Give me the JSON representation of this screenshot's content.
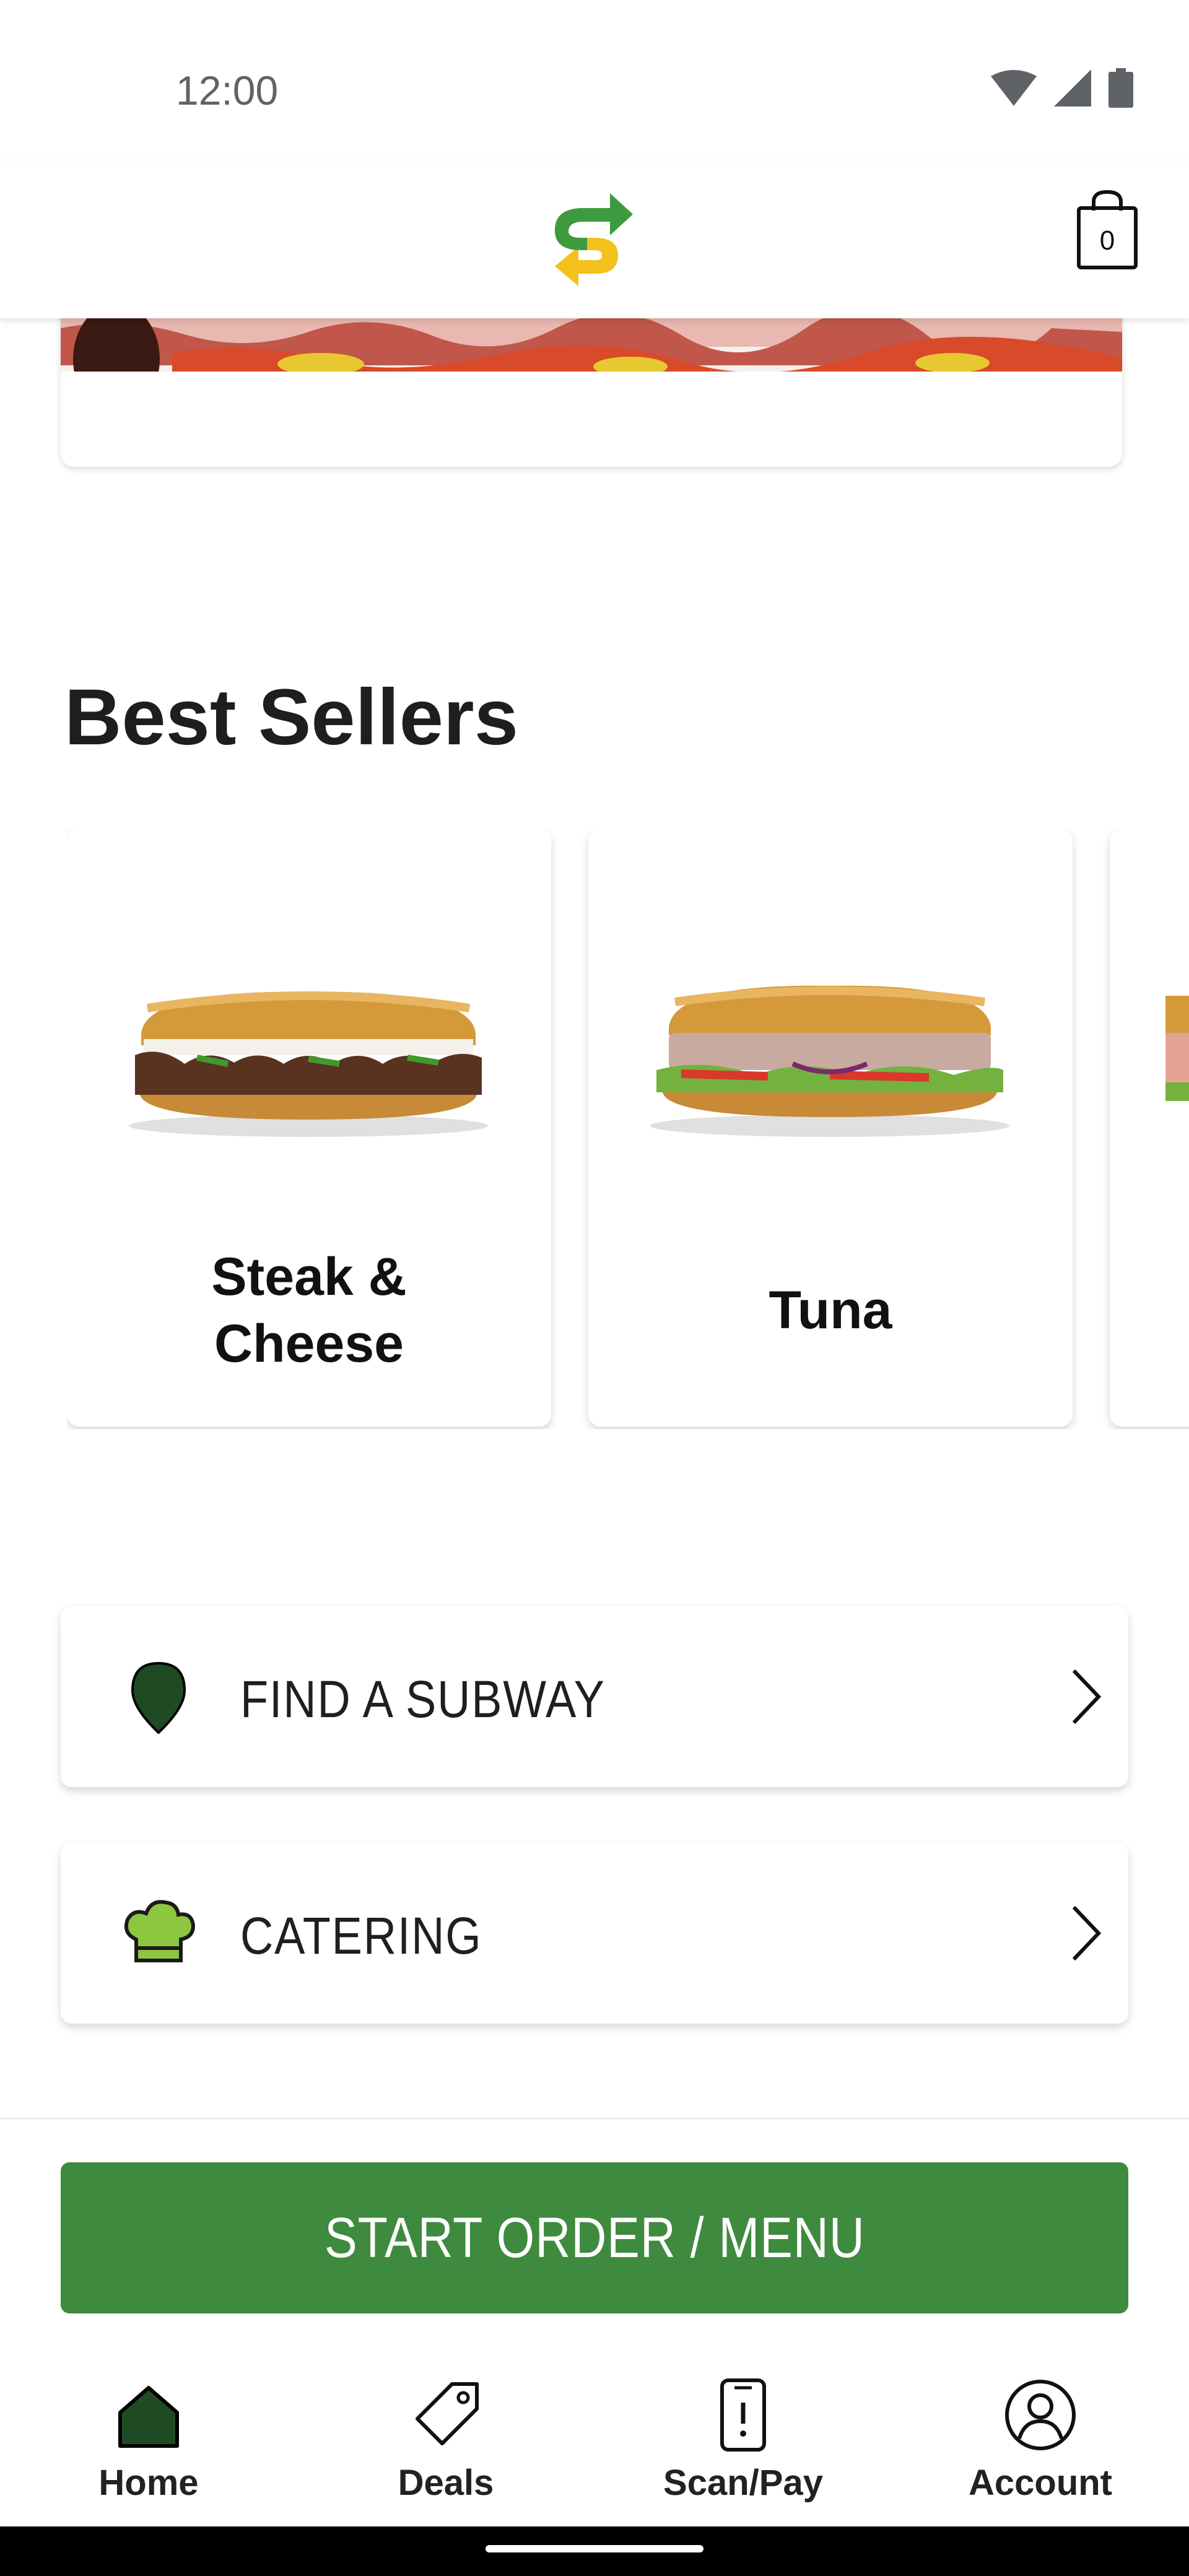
{
  "status_bar": {
    "time": "12:00"
  },
  "header": {
    "cart_count": "0"
  },
  "best_sellers": {
    "title": "Best Sellers",
    "items": [
      {
        "name_line1": "Steak &",
        "name_line2": "Cheese"
      },
      {
        "name_line1": "Tuna",
        "name_line2": ""
      }
    ]
  },
  "links": [
    {
      "label": "FIND A SUBWAY",
      "icon": "location-pin-icon"
    },
    {
      "label": "CATERING",
      "icon": "chef-hat-icon"
    }
  ],
  "cta": {
    "label": "START ORDER / MENU"
  },
  "nav": {
    "items": [
      {
        "label": "Home",
        "icon": "home-icon",
        "active": true
      },
      {
        "label": "Deals",
        "icon": "tag-icon"
      },
      {
        "label": "Scan/Pay",
        "icon": "phone-scan-icon"
      },
      {
        "label": "Account",
        "icon": "account-icon"
      }
    ]
  },
  "colors": {
    "brand_green": "#3e8a3e",
    "dark_green": "#1f4b24",
    "accent_yellow": "#f3c01c",
    "lime": "#8dc63f"
  }
}
